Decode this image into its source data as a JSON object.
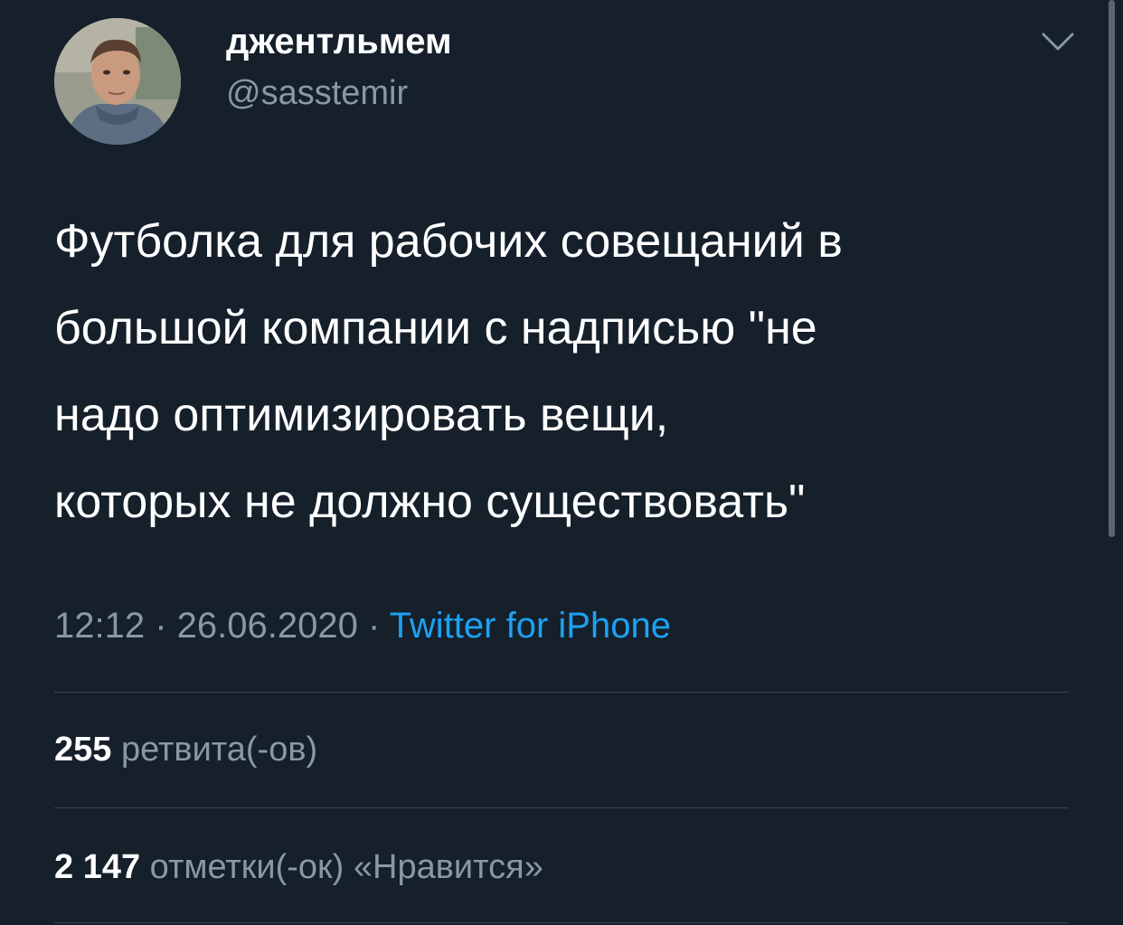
{
  "author": {
    "display_name": "джентльмем",
    "handle": "@sasstemir"
  },
  "tweet": {
    "text": "Футболка для рабочих совещаний в\nбольшой компании с надписью \"не\nнадо оптимизировать вещи,\nкоторых не должно существовать\""
  },
  "meta": {
    "time": "12:12",
    "separator": " · ",
    "date": "26.06.2020",
    "source": "Twitter for iPhone"
  },
  "stats": {
    "retweets_count": "255",
    "retweets_label": "ретвита(-ов)",
    "likes_count": "2 147",
    "likes_label": "отметки(-ок) «Нравится»"
  },
  "icons": {
    "menu": "chevron-down-icon"
  },
  "colors": {
    "background": "#15202b",
    "text_primary": "#ffffff",
    "text_secondary": "#8899a6",
    "link": "#1da1f2",
    "divider": "#38444d"
  }
}
